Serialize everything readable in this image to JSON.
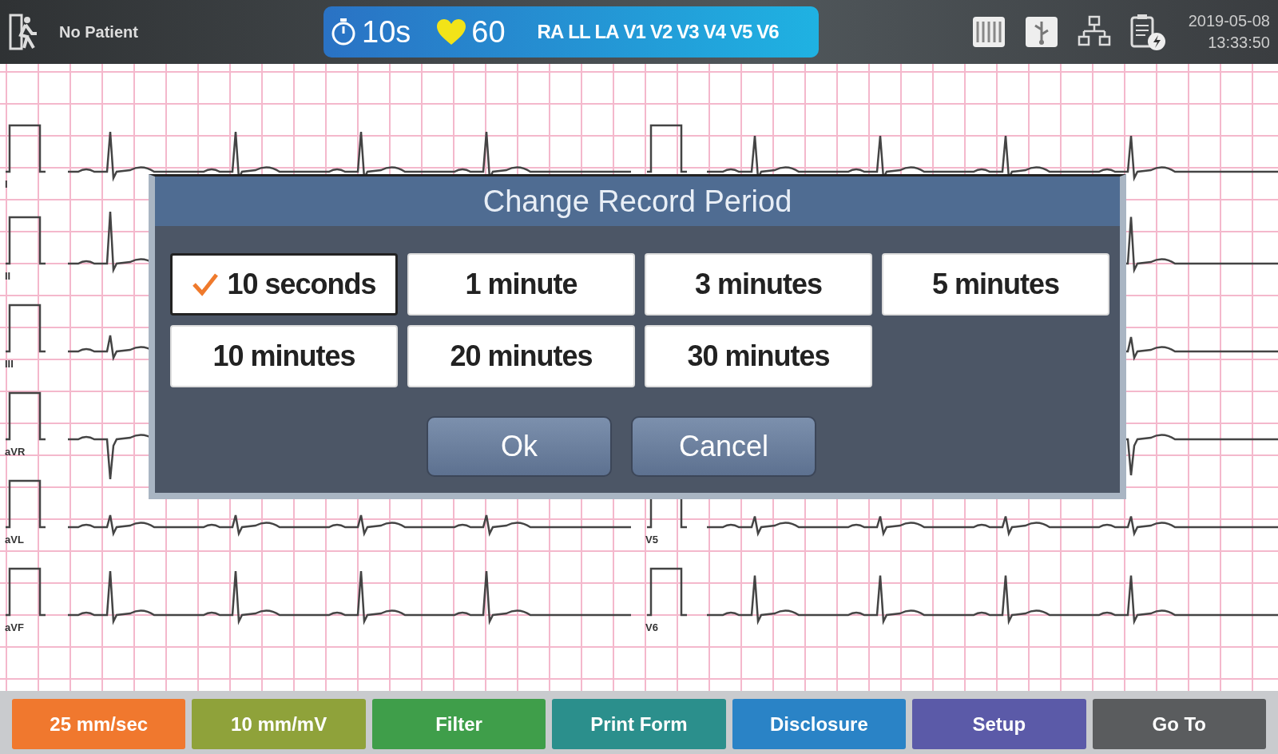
{
  "top_bar": {
    "patient": "No Patient",
    "record_period": "10s",
    "heart_rate": "60",
    "leads": [
      "RA",
      "LL",
      "LA",
      "V1",
      "V2",
      "V3",
      "V4",
      "V5",
      "V6"
    ],
    "date": "2019-05-08",
    "time": "13:33:50"
  },
  "ecg": {
    "rows": [
      {
        "left": "I"
      },
      {
        "left": "II"
      },
      {
        "left": "III"
      },
      {
        "left": "aVR"
      },
      {
        "left": "aVL",
        "right": "V5"
      },
      {
        "left": "aVF",
        "right": "V6"
      }
    ]
  },
  "dialog": {
    "title": "Change Record Period",
    "options": [
      {
        "label": "10 seconds",
        "selected": true
      },
      {
        "label": "1 minute",
        "selected": false
      },
      {
        "label": "3 minutes",
        "selected": false
      },
      {
        "label": "5 minutes",
        "selected": false
      },
      {
        "label": "10 minutes",
        "selected": false
      },
      {
        "label": "20 minutes",
        "selected": false
      },
      {
        "label": "30 minutes",
        "selected": false
      }
    ],
    "buttons": [
      "Ok",
      "Cancel"
    ]
  },
  "toolbar": [
    {
      "label": "25 mm/sec",
      "color": "#f0782e"
    },
    {
      "label": "10 mm/mV",
      "color": "#8fa23a"
    },
    {
      "label": "Filter",
      "color": "#3f9e4a"
    },
    {
      "label": "Print Form",
      "color": "#2b8f8c"
    },
    {
      "label": "Disclosure",
      "color": "#2a83c6"
    },
    {
      "label": "Setup",
      "color": "#5b5aa8"
    },
    {
      "label": "Go To",
      "color": "#5a5c5e"
    }
  ]
}
